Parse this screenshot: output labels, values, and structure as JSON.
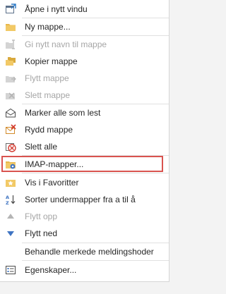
{
  "menu": {
    "items": [
      {
        "label": "Åpne i nytt vindu",
        "icon": "open-in-new-window-icon",
        "enabled": true
      },
      {
        "label": "Ny mappe...",
        "icon": "new-folder-icon",
        "enabled": true
      },
      {
        "label": "Gi nytt navn til mappe",
        "icon": "rename-folder-icon",
        "enabled": false
      },
      {
        "label": "Kopier mappe",
        "icon": "copy-folder-icon",
        "enabled": true
      },
      {
        "label": "Flytt mappe",
        "icon": "move-folder-icon",
        "enabled": false
      },
      {
        "label": "Slett mappe",
        "icon": "delete-folder-icon",
        "enabled": false
      },
      {
        "label": "Marker alle som lest",
        "icon": "mark-all-read-icon",
        "enabled": true
      },
      {
        "label": "Rydd mappe",
        "icon": "clean-up-folder-icon",
        "enabled": true
      },
      {
        "label": "Slett alle",
        "icon": "delete-all-icon",
        "enabled": true
      },
      {
        "label": "IMAP-mapper...",
        "icon": "imap-folders-icon",
        "enabled": true,
        "highlighted": true
      },
      {
        "label": "Vis i Favoritter",
        "icon": "favorites-icon",
        "enabled": true
      },
      {
        "label": "Sorter undermapper fra a til å",
        "icon": "sort-a-z-icon",
        "enabled": true
      },
      {
        "label": "Flytt opp",
        "icon": "move-up-icon",
        "enabled": false
      },
      {
        "label": "Flytt ned",
        "icon": "move-down-icon",
        "enabled": true
      },
      {
        "label": "Behandle merkede meldingshoder",
        "icon": "",
        "enabled": true
      },
      {
        "label": "Egenskaper...",
        "icon": "properties-icon",
        "enabled": true
      }
    ]
  },
  "colors": {
    "highlight_border": "#d9534f",
    "disabled_text": "#a6a6a6",
    "folder": "#e8b74a"
  }
}
